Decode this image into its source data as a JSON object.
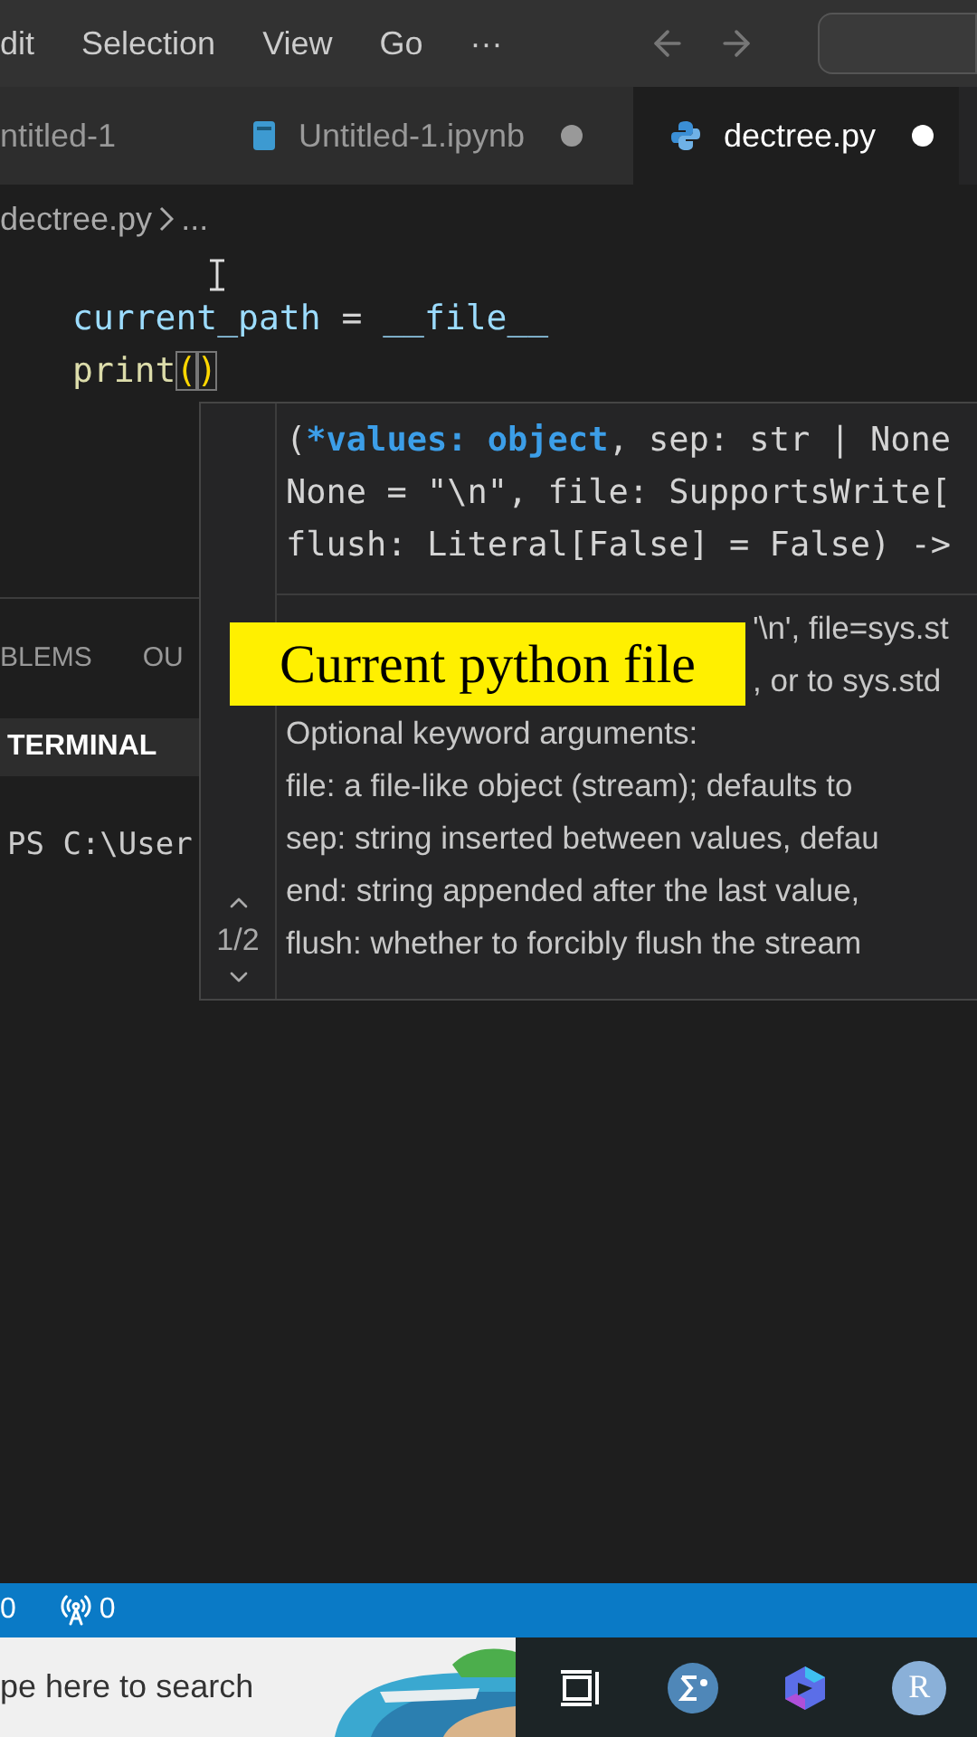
{
  "menu": [
    "dit",
    "Selection",
    "View",
    "Go",
    "···"
  ],
  "tabs": [
    {
      "label": "ntitled-1",
      "kind": "plain",
      "selected": false,
      "dirty": false
    },
    {
      "label": "Untitled-1.ipynb",
      "kind": "notebook",
      "selected": false,
      "dirty": true
    },
    {
      "label": "dectree.py",
      "kind": "python",
      "selected": true,
      "dirty": true
    }
  ],
  "breadcrumb": {
    "file": "dectree.py",
    "more": "..."
  },
  "code": [
    [
      {
        "text": "current_path",
        "kind": "var"
      },
      {
        "text": " = ",
        "kind": "op"
      },
      {
        "text": "__file__",
        "kind": "var"
      }
    ],
    [
      {
        "text": "print",
        "kind": "func"
      },
      {
        "text": "(",
        "kind": "bracket"
      },
      {
        "text": ")",
        "kind": "bracket"
      }
    ]
  ],
  "hover": {
    "signature": [
      [
        {
          "text": "(",
          "active": false
        },
        {
          "text": "*values: object",
          "active": true
        },
        {
          "text": ", sep: str | None",
          "active": false
        }
      ],
      [
        {
          "text": "None = \"\\n\", file: SupportsWrite[",
          "active": false
        }
      ],
      [
        {
          "text": "flush: Literal[False] = False) ->",
          "active": false
        }
      ]
    ],
    "counter": "1/2",
    "docs": [
      {
        "text": "'\\n', file=sys.st",
        "kind": "tail"
      },
      {
        "text": ", or to sys.std",
        "kind": "tail"
      },
      {
        "text": "Optional keyword arguments:",
        "kind": "line"
      },
      {
        "text": "file: a file-like object (stream); defaults to",
        "kind": "line"
      },
      {
        "text": "sep: string inserted between values, defau",
        "kind": "line"
      },
      {
        "text": "end: string appended after the last value,",
        "kind": "line"
      },
      {
        "text": "flush: whether to forcibly flush the stream",
        "kind": "line"
      }
    ]
  },
  "caption": "Current python file",
  "panel": {
    "tabs": [
      {
        "label": "BLEMS",
        "selected": false
      },
      {
        "label": "OU",
        "selected": false
      }
    ],
    "view": {
      "label": "TERMINAL",
      "selected": true
    },
    "terminal": "PS C:\\User"
  },
  "status_bar": [
    {
      "kind": "count",
      "text": "0"
    },
    {
      "kind": "ports",
      "text": "0"
    }
  ],
  "taskbar": {
    "search": {
      "placeholder": "pe here to search"
    },
    "apps": [
      {
        "kind": "taskview"
      },
      {
        "kind": "math"
      },
      {
        "kind": "copilot"
      },
      {
        "kind": "letter",
        "label": "R"
      }
    ]
  }
}
